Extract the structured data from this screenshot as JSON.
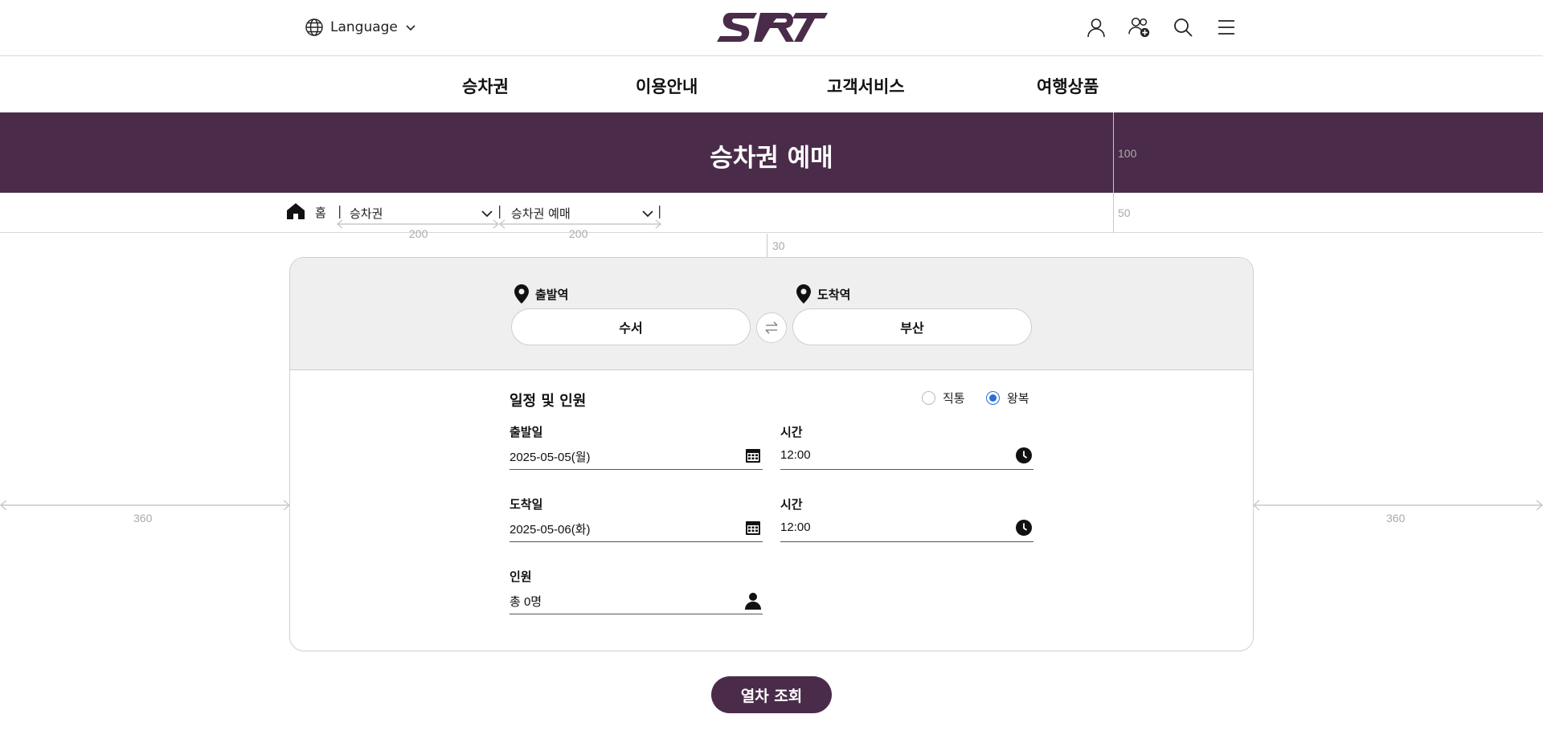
{
  "header": {
    "language_label": "Language",
    "logo_text": "SRT",
    "icons": [
      "user-icon",
      "user-add-icon",
      "search-icon",
      "menu-icon"
    ]
  },
  "nav": {
    "items": [
      {
        "label": "승차권"
      },
      {
        "label": "이용안내"
      },
      {
        "label": "고객서비스"
      },
      {
        "label": "여행상품"
      }
    ]
  },
  "banner": {
    "title": "승차권 예매",
    "color": "#4a2c4a"
  },
  "breadcrumb": {
    "home": "홈",
    "sep": "|",
    "level1": "승차권",
    "level2": "승차권 예매"
  },
  "guides": {
    "banner_height": "100",
    "crumb_height": "50",
    "crumb_width_1": "200",
    "crumb_width_2": "200",
    "gap_top": "30",
    "side_left": "360",
    "side_right": "360"
  },
  "stations": {
    "departure_label": "출발역",
    "arrival_label": "도착역",
    "departure_value": "수서",
    "arrival_value": "부산"
  },
  "schedule": {
    "title": "일정 및 인원",
    "trip_types": [
      {
        "label": "직통",
        "selected": false
      },
      {
        "label": "왕복",
        "selected": true
      }
    ],
    "depart_date_label": "출발일",
    "depart_date_value": "2025-05-05(월)",
    "depart_time_label": "시간",
    "depart_time_value": "12:00",
    "arrive_date_label": "도착일",
    "arrive_date_value": "2025-05-06(화)",
    "arrive_time_label": "시간",
    "arrive_time_value": "12:00",
    "passengers_label": "인원",
    "passengers_value": "총 0명"
  },
  "actions": {
    "search_label": "열차 조회"
  },
  "colors": {
    "brand": "#4a2c4a",
    "radio_selected": "#2a6fd6"
  }
}
